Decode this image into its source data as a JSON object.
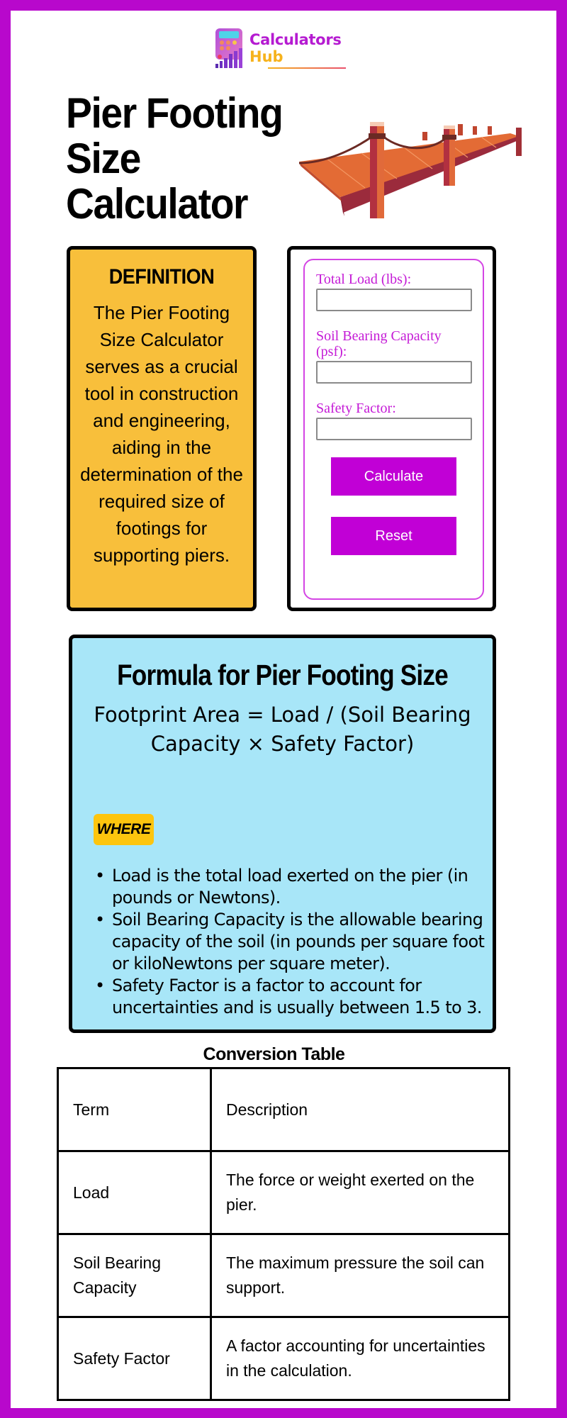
{
  "brand": {
    "name_line1": "Calculators",
    "name_line2": "Hub",
    "logo_icon": "calculator-bars-icon",
    "colors": {
      "primary": "#b808cc",
      "accent": "#f6b21b"
    }
  },
  "header": {
    "title": "Pier Footing Size Calculator",
    "illustration": "wooden-pier-illustration"
  },
  "definition": {
    "heading": "DEFINITION",
    "body": "The Pier Footing Size Calculator serves as a crucial tool in construction and engineering, aiding in the determination of the required size of footings for supporting piers.",
    "background": "#f8bf3b"
  },
  "calculator": {
    "fields": [
      {
        "label": "Total Load (lbs):",
        "value": "",
        "placeholder": ""
      },
      {
        "label": "Soil Bearing Capacity (psf):",
        "value": "",
        "placeholder": ""
      },
      {
        "label": "Safety Factor:",
        "value": "",
        "placeholder": ""
      }
    ],
    "calculate_label": "Calculate",
    "reset_label": "Reset",
    "button_color": "#c100d6"
  },
  "formula": {
    "heading": "Formula for Pier Footing Size",
    "equation": "Footprint Area = Load / (Soil Bearing Capacity × Safety Factor)",
    "where_label": "WHERE",
    "items": [
      "Load is the total load exerted on the pier (in pounds or Newtons).",
      "Soil Bearing Capacity is the allowable bearing capacity of the soil (in pounds per square foot or kiloNewtons per square meter).",
      "Safety Factor is a factor to account for uncertainties and is usually between 1.5 to 3."
    ],
    "background": "#a8e6f8"
  },
  "table": {
    "title": "Conversion Table",
    "header": [
      "Term",
      "Description"
    ],
    "rows": [
      [
        "Load",
        "The force or weight exerted on the pier."
      ],
      [
        "Soil Bearing Capacity",
        "The maximum pressure the soil can support."
      ],
      [
        "Safety Factor",
        "A factor accounting for uncertainties in the calculation."
      ]
    ]
  }
}
